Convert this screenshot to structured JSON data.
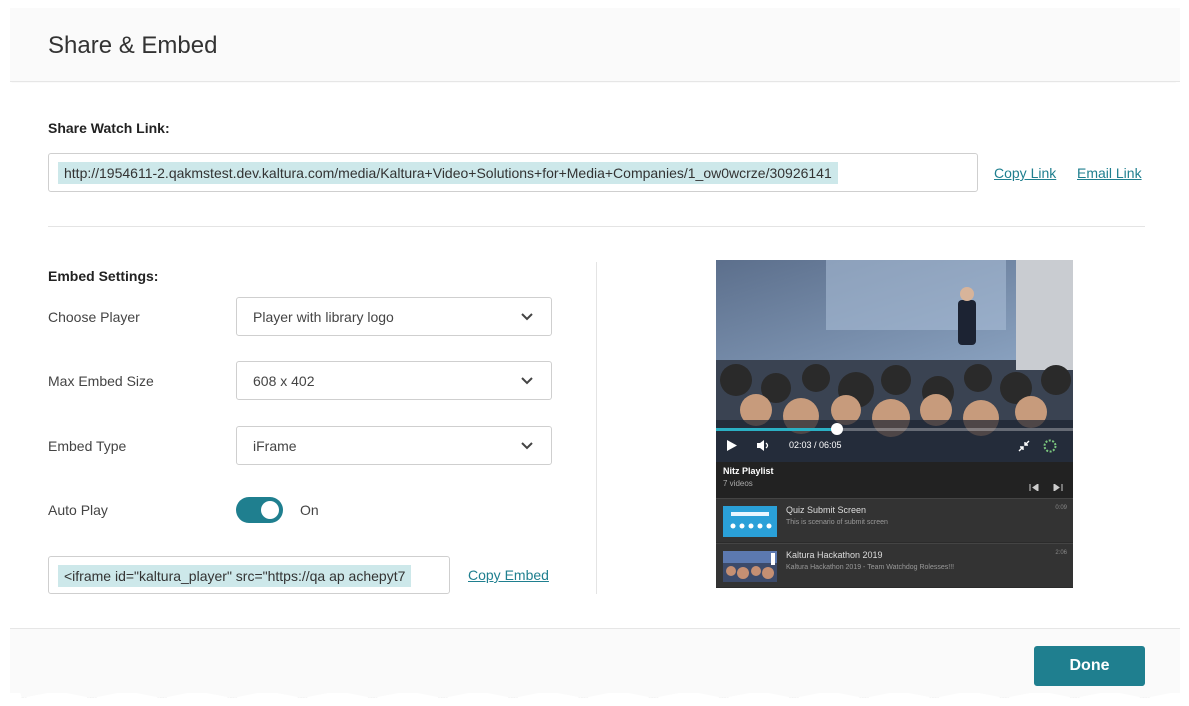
{
  "dialog": {
    "title": "Share & Embed"
  },
  "share": {
    "section_label": "Share Watch Link:",
    "url": "http://1954611-2.qakmstest.dev.kaltura.com/media/Kaltura+Video+Solutions+for+Media+Companies/1_ow0wcrze/30926141",
    "copy_link_label": "Copy Link",
    "email_link_label": "Email Link"
  },
  "embed": {
    "section_label": "Embed Settings:",
    "choose_player_label": "Choose Player",
    "choose_player_value": "Player with library logo",
    "max_size_label": "Max Embed Size",
    "max_size_value": "608 x 402",
    "embed_type_label": "Embed Type",
    "embed_type_value": "iFrame",
    "auto_play_label": "Auto Play",
    "auto_play_state": "On",
    "code": "<iframe id=\"kaltura_player\" src=\"https://qa ap achepyt7",
    "copy_embed_label": "Copy Embed"
  },
  "player": {
    "time": "02:03 / 06:05",
    "progress_fraction": 0.34,
    "playlist_title": "Nitz Playlist",
    "playlist_count": "7 videos",
    "items": [
      {
        "title": "Quiz Submit Screen",
        "desc": "This is scenario of submit screen",
        "duration": "0:09"
      },
      {
        "title": "Kaltura Hackathon 2019",
        "desc": "Kaltura Hackathon 2019 - Team Watchdog Rolesses!!!",
        "duration": "2:06"
      }
    ]
  },
  "footer": {
    "done_label": "Done"
  },
  "colors": {
    "accent": "#1f7f8f",
    "highlight": "#cde8ea"
  }
}
